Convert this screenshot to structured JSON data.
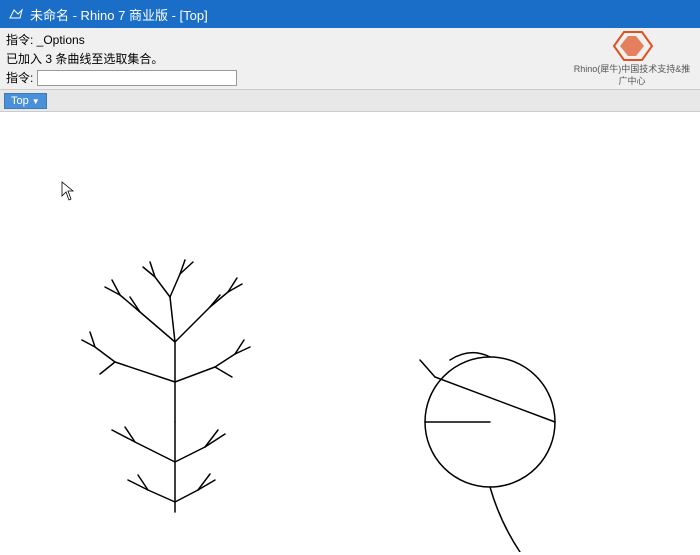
{
  "titlebar": {
    "title": "未命名 - Rhino 7 商业版 - [Top]"
  },
  "commands": {
    "cmd1_label": "指令: _Options",
    "cmd2_label": "已加入 3 条曲线至选取集合。",
    "cmd3_prefix": "指令:",
    "cmd3_value": ""
  },
  "viewport": {
    "label": "Top",
    "dropdown_arrow": "▼"
  },
  "logo": {
    "line1": "Rhino(犀牛)中国技术支持&推广中心"
  }
}
